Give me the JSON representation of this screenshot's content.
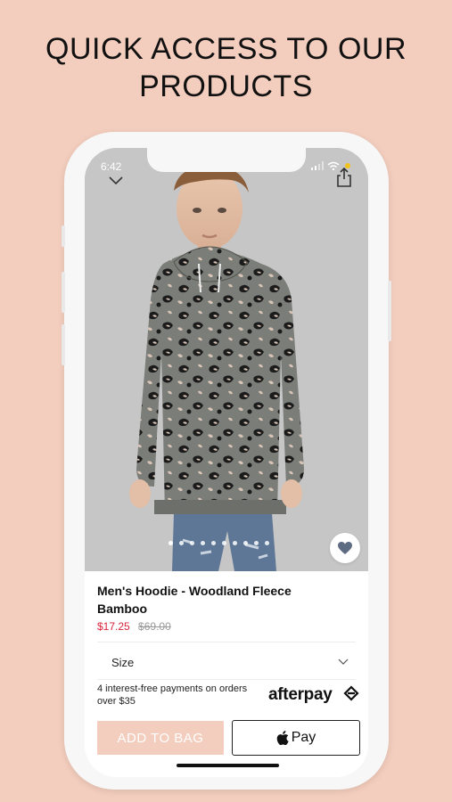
{
  "headline": {
    "line1": "QUICK ACCESS TO OUR",
    "line2": "PRODUCTS"
  },
  "status_bar": {
    "time": "6:42",
    "icons": [
      "location-arrow-icon",
      "signal-icon",
      "wifi-icon",
      "battery-icon"
    ]
  },
  "toolbar": {
    "back_icon": "chevron-down-icon",
    "share_icon": "share-icon"
  },
  "gallery": {
    "image_count": 10,
    "active_index": 0,
    "favorite_icon": "heart-icon"
  },
  "product": {
    "title": "Men's Hoodie - Woodland Fleece Bamboo",
    "price": "$17.25",
    "original_price": "$69.00"
  },
  "size_select": {
    "label": "Size",
    "icon": "chevron-down-icon"
  },
  "payment_info": {
    "text": "4 interest-free payments on orders over $35",
    "brand": "afterpay"
  },
  "actions": {
    "add_to_bag": "ADD TO BAG",
    "apple_pay": "Pay"
  },
  "colors": {
    "background": "#f3cdbd",
    "sale_price": "#d6223a",
    "add_to_bag_bg": "#f3cdbd"
  }
}
